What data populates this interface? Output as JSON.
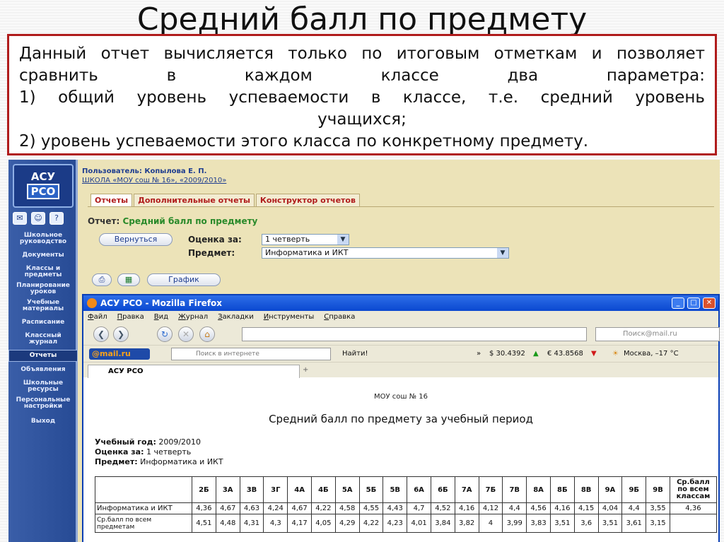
{
  "slide": {
    "title": "Средний балл по предмету",
    "note_lines": [
      "Данный отчет вычисляется только по итоговым отметкам и позволяет",
      "сравнить в каждом классе два параметра:",
      "1) общий уровень успеваемости в классе, т.е. средний уровень",
      "учащихся;",
      "2) уровень успеваемости этого класса по конкретному предмету."
    ]
  },
  "app": {
    "logo_top": "АСУ",
    "logo_bottom": "РСО",
    "user_line": "Пользователь: Копылова Е. П.",
    "school_line": "ШКОЛА «МОУ сош № 16», «2009/2010»",
    "sidebar_items": [
      "Школьное руководство",
      "Документы",
      "Классы и предметы",
      "Планирование уроков",
      "Учебные материалы",
      "Расписание",
      "Классный журнал",
      "Отчеты",
      "Объявления",
      "Школьные ресурсы",
      "Персональные настройки",
      "Выход"
    ],
    "tabs": [
      "Отчеты",
      "Дополнительные отчеты",
      "Конструктор отчетов"
    ],
    "report_prefix": "Отчет:",
    "report_name": "Средний балл по предмету",
    "back_button": "Вернуться",
    "grade_label": "Оценка за:",
    "grade_value": "1 четверть",
    "subject_label": "Предмет:",
    "subject_value": "Информатика и ИКТ",
    "chart_button": "График"
  },
  "browser": {
    "window_title": "АСУ РСО - Mozilla Firefox",
    "menu": [
      "Файл",
      "Правка",
      "Вид",
      "Журнал",
      "Закладки",
      "Инструменты",
      "Справка"
    ],
    "search_placeholder": "Поиск@mail.ru",
    "mailru_logo": "@mail.ru",
    "internet_search_placeholder": "Поиск в интернете",
    "find_button": "Найти!",
    "usd": "$ 30.4392",
    "eur": "€ 43.8568",
    "weather": "Москва, –17 °С",
    "tab_title": "АСУ РСО"
  },
  "report": {
    "school": "МОУ сош № 16",
    "title": "Средний балл по предмету за учебный период",
    "year_label": "Учебный год:",
    "year_value": "2009/2010",
    "grade_label": "Оценка за:",
    "grade_value": "1 четверть",
    "subject_label": "Предмет:",
    "subject_value": "Информатика и ИКТ",
    "columns": [
      "2Б",
      "3А",
      "3В",
      "3Г",
      "4А",
      "4Б",
      "5А",
      "5Б",
      "5В",
      "6А",
      "6Б",
      "7А",
      "7Б",
      "7В",
      "8А",
      "8Б",
      "8В",
      "9А",
      "9Б",
      "9В"
    ],
    "summary_header": "Ср.балл по всем классам",
    "rows": [
      {
        "label": "Информатика и ИКТ",
        "values": [
          "4,36",
          "4,67",
          "4,63",
          "4,24",
          "4,67",
          "4,22",
          "4,58",
          "4,55",
          "4,43",
          "4,7",
          "4,52",
          "4,16",
          "4,12",
          "4,4",
          "4,56",
          "4,16",
          "4,15",
          "4,04",
          "4,4",
          "3,55"
        ],
        "summary": "4,36"
      },
      {
        "label": "Ср.балл по всем предметам",
        "values": [
          "4,51",
          "4,48",
          "4,31",
          "4,3",
          "4,17",
          "4,05",
          "4,29",
          "4,22",
          "4,23",
          "4,01",
          "3,84",
          "3,82",
          "4",
          "3,99",
          "3,83",
          "3,51",
          "3,6",
          "3,51",
          "3,61",
          "3,15"
        ],
        "summary": ""
      }
    ]
  }
}
